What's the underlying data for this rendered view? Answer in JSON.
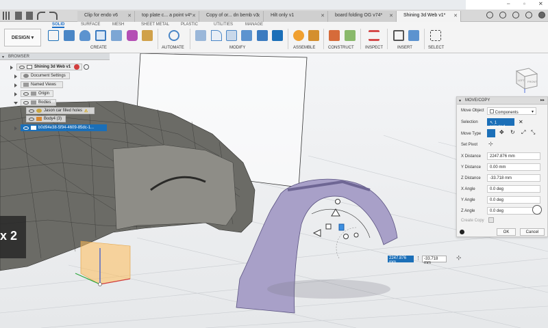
{
  "tabs": [
    {
      "label": "Clip for endo v6",
      "active": false
    },
    {
      "label": "top plate c... a point v4*",
      "active": false
    },
    {
      "label": "Copy of or... dn bemb v3",
      "active": false
    },
    {
      "label": "Hilt only v1",
      "active": false
    },
    {
      "label": "board folding OG v74*",
      "active": false
    },
    {
      "label": "Shining 3d Web v1*",
      "active": true
    }
  ],
  "ribbon": {
    "workspace": "DESIGN",
    "workspace_tabs": [
      "SOLID",
      "SURFACE",
      "MESH",
      "SHEET METAL",
      "PLASTIC",
      "UTILITIES",
      "MANAGE"
    ],
    "groups": [
      "CREATE",
      "AUTOMATE",
      "MODIFY",
      "ASSEMBLE",
      "CONSTRUCT",
      "INSPECT",
      "INSERT",
      "SELECT"
    ]
  },
  "browser": {
    "title": "BROWSER",
    "root": "Shining 3d Web v1",
    "nodes": [
      "Document Settings",
      "Named Views",
      "Origin",
      "Bodies",
      "Jason car filled holes",
      "Body4 (3)",
      "b0d94e38-5f94-4609-85dc-1..."
    ]
  },
  "move_panel": {
    "title": "MOVE/COPY",
    "rows": [
      {
        "label": "Move Object",
        "value": "Components"
      },
      {
        "label": "Selection",
        "value": "1 selected"
      },
      {
        "label": "Move Type",
        "value": ""
      },
      {
        "label": "Set Pivot",
        "value": ""
      },
      {
        "label": "X Distance",
        "value": "2247.876 mm"
      },
      {
        "label": "Y Distance",
        "value": "0.00 mm"
      },
      {
        "label": "Z Distance",
        "value": "-33.718 mm"
      },
      {
        "label": "X Angle",
        "value": "0.0 deg"
      },
      {
        "label": "Y Angle",
        "value": "0.0 deg"
      },
      {
        "label": "Z Angle",
        "value": "0.0 deg"
      },
      {
        "label": "Create Copy",
        "value": ""
      }
    ],
    "ok": "OK",
    "cancel": "Cancel"
  },
  "viewport": {
    "overlay_text": "x 2",
    "dist_input": "2247.876 mm",
    "dist_input2": "-33.718 mm",
    "viewcube_front": "LEFT",
    "viewcube_side": "FRONT"
  },
  "colors": {
    "accent": "#1b6fb8",
    "fender": "#a8a0c8",
    "body": "#6b6b66"
  }
}
